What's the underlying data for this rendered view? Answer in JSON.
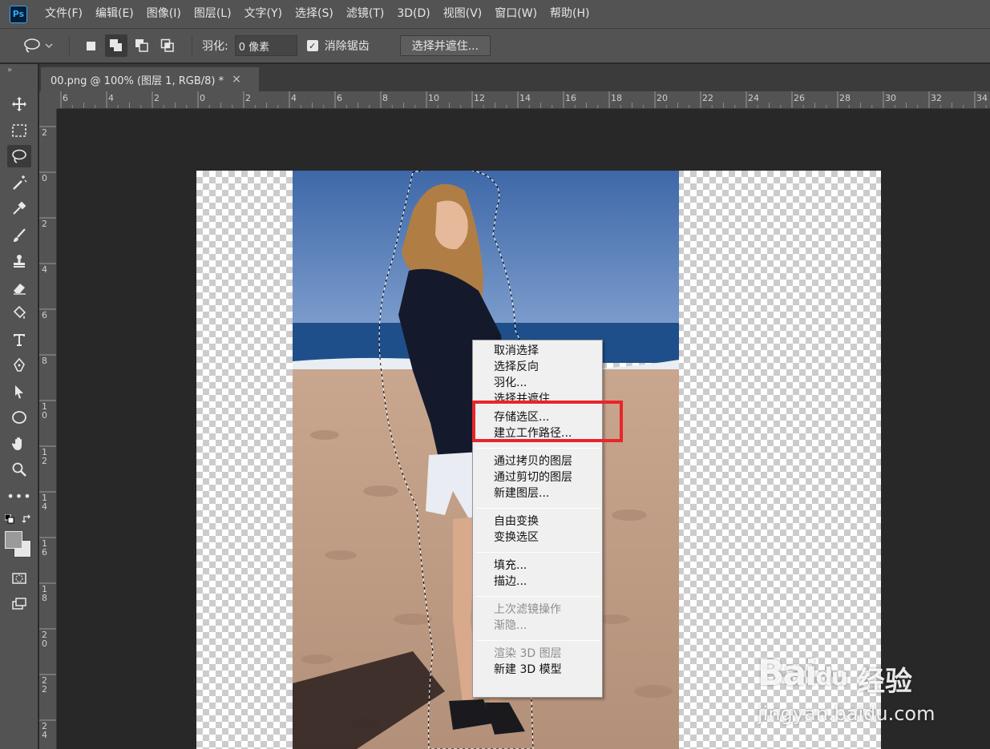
{
  "app": {
    "logo_text": "Ps"
  },
  "menubar": {
    "items": [
      "文件(F)",
      "编辑(E)",
      "图像(I)",
      "图层(L)",
      "文字(Y)",
      "选择(S)",
      "滤镜(T)",
      "3D(D)",
      "视图(V)",
      "窗口(W)",
      "帮助(H)"
    ]
  },
  "options": {
    "feather_label": "羽化:",
    "feather_value": "0 像素",
    "antialias_label": "消除锯齿",
    "antialias_checked": true,
    "refine_button": "选择并遮住..."
  },
  "document": {
    "tab_title": "00.png @ 100% (图层 1, RGB/8) *",
    "close_glyph": "×"
  },
  "rulers": {
    "horizontal_ticks": [
      "6",
      "4",
      "2",
      "0",
      "2",
      "4",
      "6",
      "8",
      "10",
      "12",
      "14",
      "16",
      "18",
      "20",
      "22",
      "24",
      "26",
      "28",
      "30",
      "32",
      "34"
    ],
    "vertical_ticks": [
      "2",
      "0",
      "2",
      "4",
      "6",
      "8",
      "1 0",
      "1 2",
      "1 4",
      "1 6",
      "1 8",
      "2 0",
      "2 2",
      "2 4"
    ]
  },
  "context_menu": {
    "groups": [
      [
        "取消选择",
        "选择反向",
        "羽化...",
        "选择并遮住..."
      ],
      [
        "存储选区...",
        "建立工作路径..."
      ],
      [
        "通过拷贝的图层",
        "通过剪切的图层",
        "新建图层..."
      ],
      [
        "自由变换",
        "变换选区"
      ],
      [
        "填充...",
        "描边..."
      ],
      [
        "上次滤镜操作",
        "渐隐..."
      ],
      [
        "渲染 3D 图层",
        "新建 3D 模型"
      ]
    ],
    "disabled": [
      "上次滤镜操作",
      "渐隐...",
      "渲染 3D 图层"
    ],
    "highlighted_item": "存储选区..."
  },
  "watermark": {
    "main": "Bai",
    "paw": "du",
    "cn": "经验",
    "sub": "jingyan.baidu.com"
  },
  "colors": {
    "highlight_box": "#e8252a",
    "ui_bg": "#535353",
    "canvas_bg": "#282828"
  }
}
